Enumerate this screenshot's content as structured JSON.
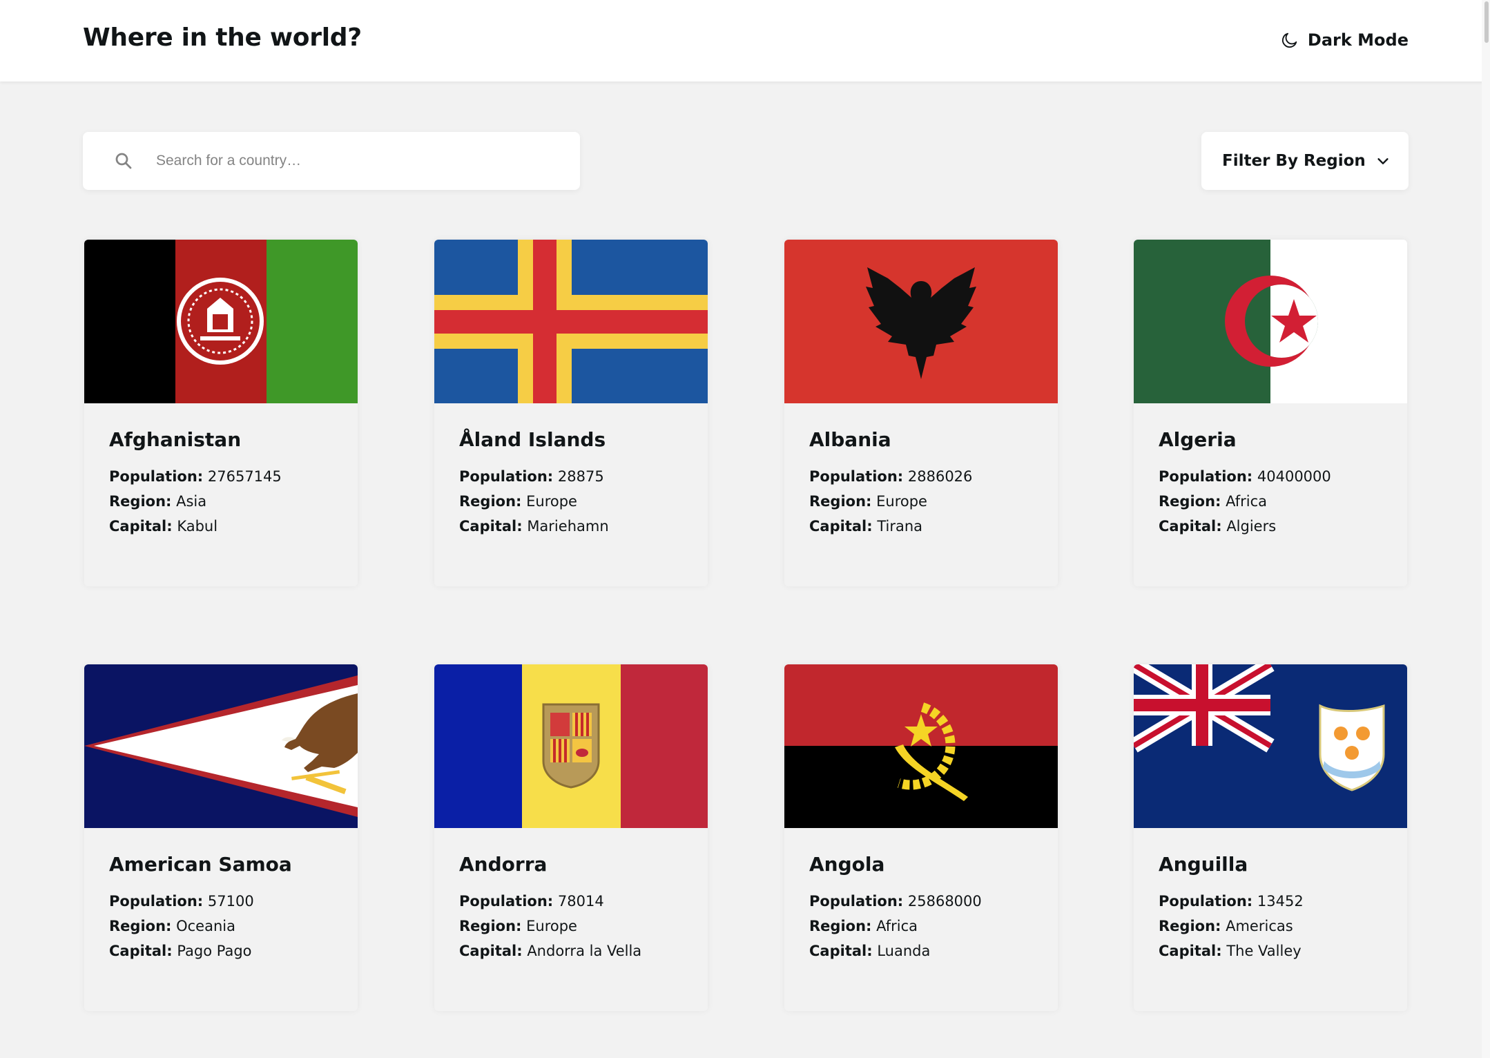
{
  "header": {
    "title": "Where in the world?",
    "dark_mode_label": "Dark Mode"
  },
  "search": {
    "placeholder": "Search for a country…"
  },
  "filter": {
    "label": "Filter By Region"
  },
  "labels": {
    "population": "Population:",
    "region": "Region:",
    "capital": "Capital:"
  },
  "countries": [
    {
      "name": "Afghanistan",
      "population": "27657145",
      "region": "Asia",
      "capital": "Kabul"
    },
    {
      "name": "Åland Islands",
      "population": "28875",
      "region": "Europe",
      "capital": "Mariehamn"
    },
    {
      "name": "Albania",
      "population": "2886026",
      "region": "Europe",
      "capital": "Tirana"
    },
    {
      "name": "Algeria",
      "population": "40400000",
      "region": "Africa",
      "capital": "Algiers"
    },
    {
      "name": "American Samoa",
      "population": "57100",
      "region": "Oceania",
      "capital": "Pago Pago"
    },
    {
      "name": "Andorra",
      "population": "78014",
      "region": "Europe",
      "capital": "Andorra la Vella"
    },
    {
      "name": "Angola",
      "population": "25868000",
      "region": "Africa",
      "capital": "Luanda"
    },
    {
      "name": "Anguilla",
      "population": "13452",
      "region": "Americas",
      "capital": "The Valley"
    }
  ],
  "colors": {
    "background": "#f2f2f2",
    "surface": "#ffffff",
    "text": "#111517"
  }
}
